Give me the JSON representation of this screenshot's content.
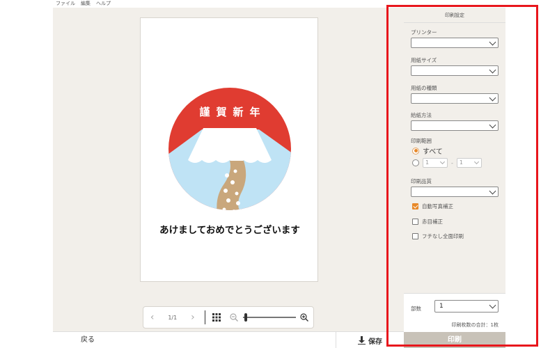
{
  "menu": [
    "ファイル",
    "編集",
    "ヘルプ"
  ],
  "card": {
    "headline": [
      "謹",
      "賀",
      "新",
      "年"
    ],
    "greeting": "あけましておめでとうございます"
  },
  "viewer": {
    "page_indicator": "1/1"
  },
  "bottom": {
    "back_label": "戻る",
    "save_label": "保存"
  },
  "panel": {
    "title": "印刷設定",
    "printer_label": "プリンター",
    "paper_size_label": "用紙サイズ",
    "paper_type_label": "用紙の種類",
    "feed_label": "給紙方法",
    "range_label": "印刷範囲",
    "range_all": "すべて",
    "range_from": "1",
    "range_to": "1",
    "quality_label": "印刷品質",
    "checks": [
      {
        "label": "自動写真補正",
        "checked": true
      },
      {
        "label": "赤目補正",
        "checked": false
      },
      {
        "label": "フチなし全面印刷",
        "checked": false
      }
    ],
    "copies_label": "部数",
    "copies_value": "1",
    "total_text": "印刷枚数の合計：1枚",
    "print_label": "印刷"
  },
  "colors": {
    "accent": "#e8892a",
    "circle_red": "#e03c31",
    "sky": "#bfe3f5",
    "highlight": "#e8161c"
  }
}
